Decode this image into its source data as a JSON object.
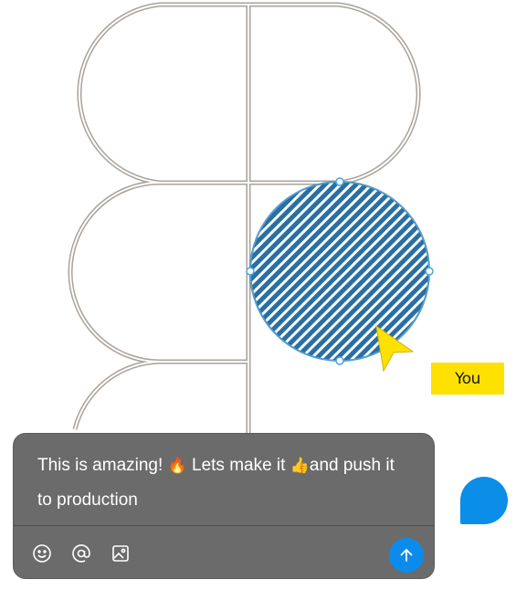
{
  "canvas": {
    "selected_shape": "hatched-circle",
    "selection_color": "#4aa3e0",
    "shape_stroke_color": "#a9a29b",
    "hatch_colors": [
      "#2a6fa3",
      "#ffffff"
    ]
  },
  "collaborator": {
    "cursor_label": "You",
    "cursor_color": "#ffe100"
  },
  "comment": {
    "text_before_fire": "This is amazing! ",
    "fire_emoji": "🔥",
    "text_middle": " Lets make it ",
    "thumbs_emoji": "👍",
    "text_after": "and push it to production",
    "card_color": "#6b6b6b",
    "toolbar": {
      "emoji_icon": "smiley-icon",
      "mention_icon": "at-sign-icon",
      "image_icon": "image-icon",
      "send_icon": "arrow-up-icon"
    },
    "send_color": "#0b8cec"
  },
  "avatar_bubble_color": "#0a8ee8"
}
